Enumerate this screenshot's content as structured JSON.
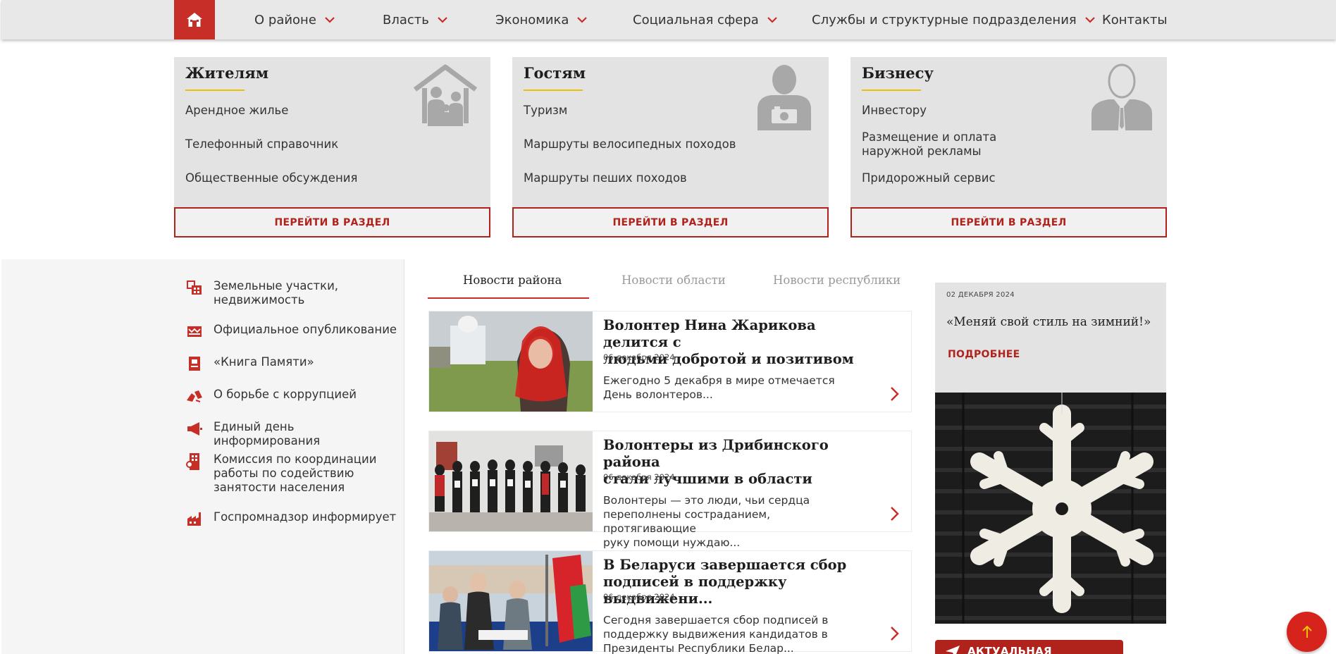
{
  "nav": {
    "items": [
      {
        "label": "О районе",
        "has_dropdown": true
      },
      {
        "label": "Власть",
        "has_dropdown": true
      },
      {
        "label": "Экономика",
        "has_dropdown": true
      },
      {
        "label": "Социальная сфера",
        "has_dropdown": true
      },
      {
        "label": "Службы и структурные подразделения",
        "has_dropdown": true
      },
      {
        "label": "Контакты",
        "has_dropdown": false
      }
    ],
    "home_icon": "home-icon"
  },
  "cards": [
    {
      "title": "Жителям",
      "icon": "family-house-icon",
      "links": [
        "Арендное жилье",
        "Телефонный справочник",
        "Общественные обсуждения"
      ],
      "button": "ПЕРЕЙТИ В РАЗДЕЛ"
    },
    {
      "title": "Гостям",
      "icon": "tourist-camera-icon",
      "links": [
        "Туризм",
        "Маршруты велосипедных походов",
        "Маршруты пеших походов"
      ],
      "button": "ПЕРЕЙТИ В РАЗДЕЛ"
    },
    {
      "title": "Бизнесу",
      "icon": "businessman-icon",
      "links": [
        "Инвестору",
        "Размещение и оплата наружной рекламы",
        "Придорожный сервис"
      ],
      "button": "ПЕРЕЙТИ В РАЗДЕЛ"
    }
  ],
  "sidebar": {
    "items": [
      {
        "label": "Земельные участки, недвижимость",
        "icon": "land-property-icon"
      },
      {
        "label": "Официальное опубликование",
        "icon": "publication-icon"
      },
      {
        "label": "«Книга Памяти»",
        "icon": "memory-book-icon"
      },
      {
        "label": "О борьбе с коррупцией",
        "icon": "anti-corruption-icon"
      },
      {
        "label": "Единый день информирования",
        "icon": "megaphone-icon"
      },
      {
        "label": "Комиссия по координации работы по содействию занятости населения",
        "icon": "employment-icon"
      },
      {
        "label": "Госпромнадзор информирует",
        "icon": "factory-icon"
      }
    ]
  },
  "news_tabs": [
    {
      "label": "Новости района",
      "active": true
    },
    {
      "label": "Новости области",
      "active": false
    },
    {
      "label": "Новости республики",
      "active": false
    }
  ],
  "news": [
    {
      "title": "Волонтер Нина Жарикова делится с\nлюдьми добротой и позитивом",
      "date": "06 декабря 2024",
      "text": "Ежегодно 5 декабря в мире отмечается\nДень волонтеров..."
    },
    {
      "title": "Волонтеры из Дрибинского района\nстали лучшими в области",
      "date": "06 декабря 2024",
      "text": "Волонтеры — это люди, чьи сердца\nпереполнены состраданием, протягивающие\nруку помощи нуждаю..."
    },
    {
      "title": "В Беларуси завершается сбор\nподписей в поддержку выдвижени...",
      "date": "06 декабря 2024",
      "text": "Сегодня завершается сбор подписей в\nподдержку выдвижения кандидатов в\nПрезиденты Республики Белар..."
    }
  ],
  "promo": {
    "date": "02 ДЕКАБРЯ 2024",
    "title": "«Меняй свой стиль на зимний!»",
    "more": "ПОДРОБНЕЕ"
  },
  "actual_button": {
    "label": "АКТУАЛЬНАЯ ИНФОРМАЦИЯ",
    "icon": "send-icon"
  },
  "colors": {
    "accent": "#c62e27",
    "underline": "#e9c100",
    "card_bg": "#e3e3e3"
  }
}
